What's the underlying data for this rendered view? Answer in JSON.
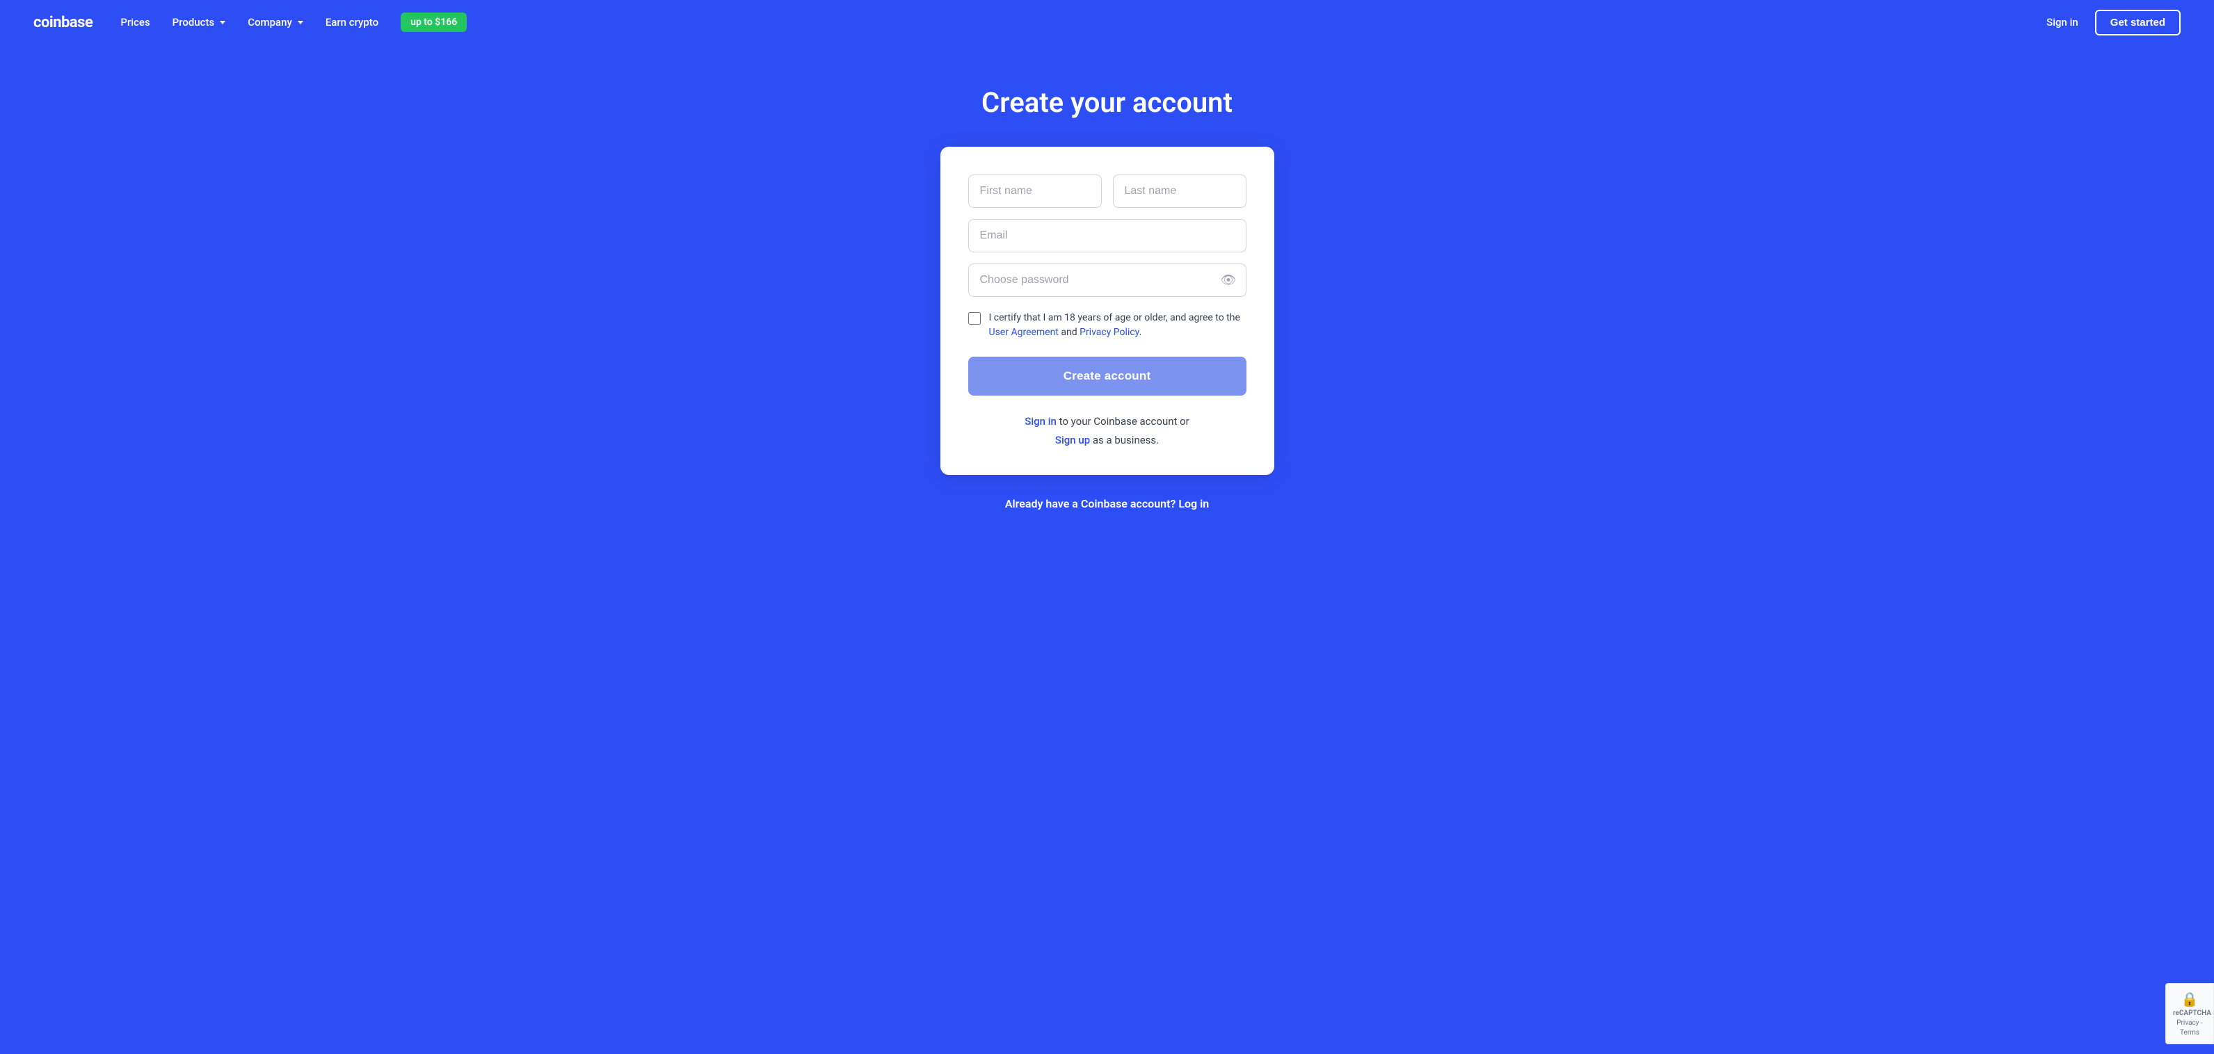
{
  "nav": {
    "logo": "coinbase",
    "links": [
      {
        "label": "Prices",
        "hasDropdown": false
      },
      {
        "label": "Products",
        "hasDropdown": true
      },
      {
        "label": "Company",
        "hasDropdown": true
      },
      {
        "label": "Earn crypto",
        "hasDropdown": false
      }
    ],
    "earn_badge": "up to $166",
    "sign_in": "Sign in",
    "get_started": "Get started"
  },
  "page": {
    "title": "Create your account"
  },
  "form": {
    "first_name_placeholder": "First name",
    "last_name_placeholder": "Last name",
    "email_placeholder": "Email",
    "password_placeholder": "Choose password",
    "checkbox_text": "I certify that I am 18 years of age or older, and agree to the ",
    "user_agreement": "User Agreement",
    "and_text": " and ",
    "privacy_policy": "Privacy Policy",
    "period": ".",
    "create_account_btn": "Create account",
    "sign_in_link": "Sign in",
    "sign_in_suffix": " to your Coinbase account or",
    "sign_up_link": "Sign up",
    "sign_up_suffix": " as a business."
  },
  "footer": {
    "already_text": "Already have a Coinbase account? Log in"
  },
  "recaptcha": {
    "line1": "reCAPTCHA",
    "line2": "Privacy - Terms"
  }
}
